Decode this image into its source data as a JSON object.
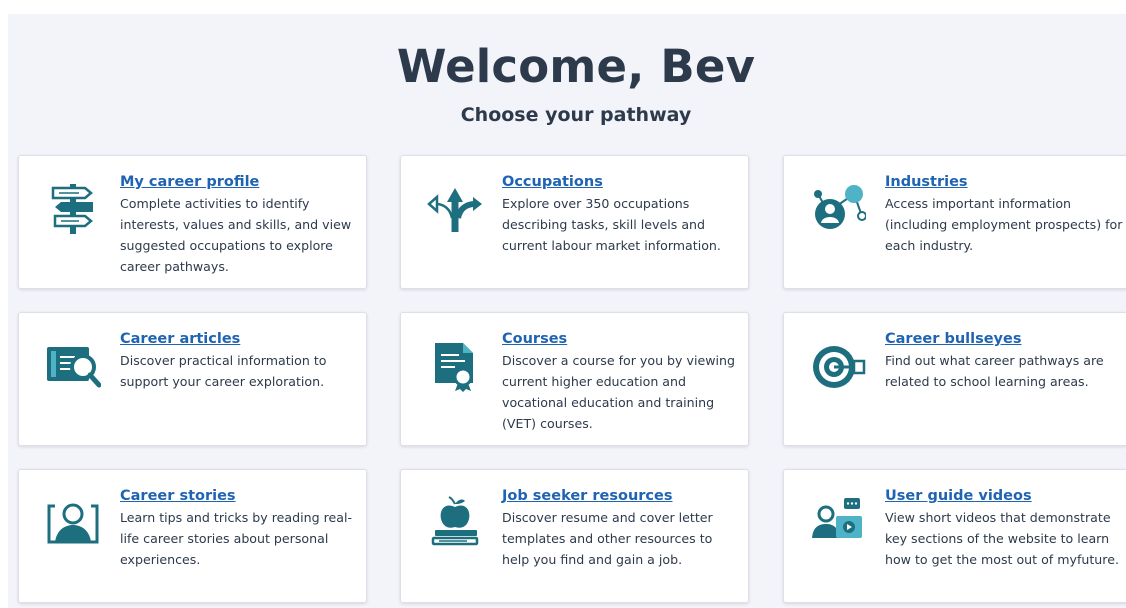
{
  "header": {
    "welcome": "Welcome, Bev",
    "subtitle": "Choose your pathway"
  },
  "cards": [
    {
      "title": "My career profile",
      "description": "Complete activities to identify interests, values and skills, and view suggested occupations to explore career pathways.",
      "icon": "signpost-icon"
    },
    {
      "title": "Occupations",
      "description": "Explore over 350 occupations describing tasks, skill levels and current labour market information.",
      "icon": "split-arrows-icon"
    },
    {
      "title": "Industries",
      "description": "Access important information (including employment prospects) for each industry.",
      "icon": "network-person-icon"
    },
    {
      "title": "Career articles",
      "description": "Discover practical information to support your career exploration.",
      "icon": "article-magnifier-icon"
    },
    {
      "title": "Courses",
      "description": "Discover a course for you by viewing current higher education and vocational education and training (VET) courses.",
      "icon": "certificate-icon"
    },
    {
      "title": "Career bullseyes",
      "description": "Find out what career pathways are related to school learning areas.",
      "icon": "bullseye-icon"
    },
    {
      "title": "Career stories",
      "description": "Learn tips and tricks by reading real-life career stories about personal experiences.",
      "icon": "person-frame-icon"
    },
    {
      "title": "Job seeker resources",
      "description": "Discover resume and cover letter templates and other resources to help you find and gain a job.",
      "icon": "apple-books-icon"
    },
    {
      "title": "User guide videos",
      "description": "View short videos that demonstrate key sections of the website to learn how to get the most out of myfuture.",
      "icon": "video-guide-icon"
    }
  ],
  "colors": {
    "icon": "#1d6f7f",
    "icon_light": "#4fb3c8",
    "link": "#1f63b3",
    "heading": "#2d3a4b",
    "background": "#f3f4fa"
  }
}
